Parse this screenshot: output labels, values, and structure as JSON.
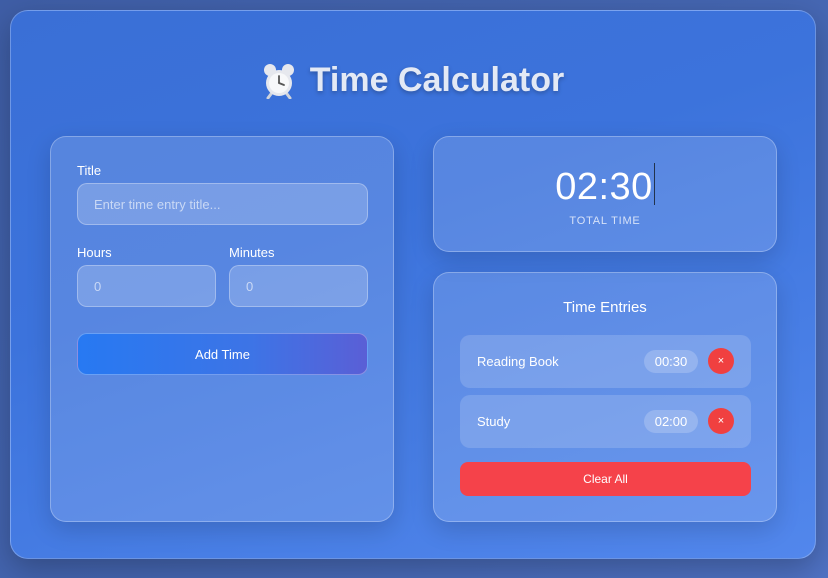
{
  "header": {
    "title": "Time Calculator",
    "icon": "alarm-clock-icon"
  },
  "form": {
    "title_label": "Title",
    "title_placeholder": "Enter time entry title...",
    "title_value": "",
    "hours_label": "Hours",
    "hours_placeholder": "0",
    "minutes_label": "Minutes",
    "minutes_placeholder": "0",
    "add_button_label": "Add Time"
  },
  "total": {
    "value": "02:30",
    "caption": "TOTAL TIME"
  },
  "entries": {
    "heading": "Time Entries",
    "items": [
      {
        "name": "Reading Book",
        "time": "00:30",
        "delete_label": "×"
      },
      {
        "name": "Study",
        "time": "02:00",
        "delete_label": "×"
      }
    ],
    "clear_label": "Clear All"
  },
  "colors": {
    "accent_blue": "#2779f2",
    "danger_red": "#f04040",
    "app_background": "#3c73dc"
  }
}
